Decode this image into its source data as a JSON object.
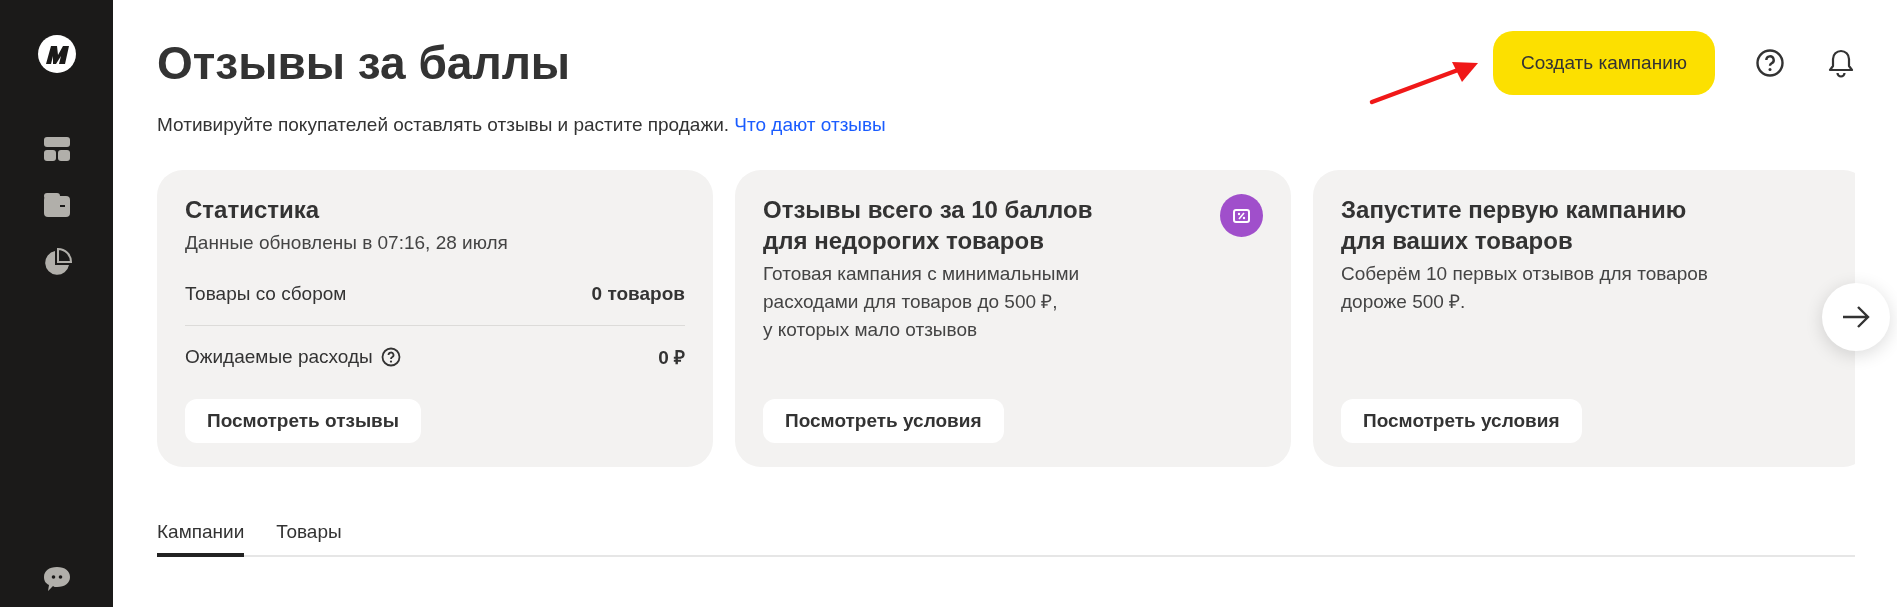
{
  "header": {
    "title": "Отзывы за баллы",
    "create_button": "Создать кампанию",
    "subtitle": "Мотивируйте покупателей оставлять отзывы и растите продажи.",
    "subtitle_link": "Что дают отзывы"
  },
  "cards": [
    {
      "kind": "stats",
      "title": "Статистика",
      "subtitle": "Данные обновлены в 07:16, 28 июля",
      "rows": [
        {
          "label": "Товары со сбором",
          "value": "0 товаров",
          "help": false
        },
        {
          "label": "Ожидаемые расходы",
          "value": "0 ₽",
          "help": true
        }
      ],
      "button": "Посмотреть отзывы"
    },
    {
      "kind": "promo",
      "title": "Отзывы всего за 10 баллов\nдля недорогих товаров",
      "text": "Готовая кампания с минимальными\nрасходами для товаров до 500 ₽,\nу которых мало отзывов",
      "badge": true,
      "button": "Посмотреть условия"
    },
    {
      "kind": "promo",
      "title": "Запустите первую кампанию\nдля ваших товаров",
      "text": "Соберём 10 первых отзывов для товаров\nдороже 500 ₽.",
      "badge": false,
      "button": "Посмотреть условия"
    }
  ],
  "tabs": [
    {
      "label": "Кампании",
      "selected": true
    },
    {
      "label": "Товары",
      "selected": false
    }
  ]
}
